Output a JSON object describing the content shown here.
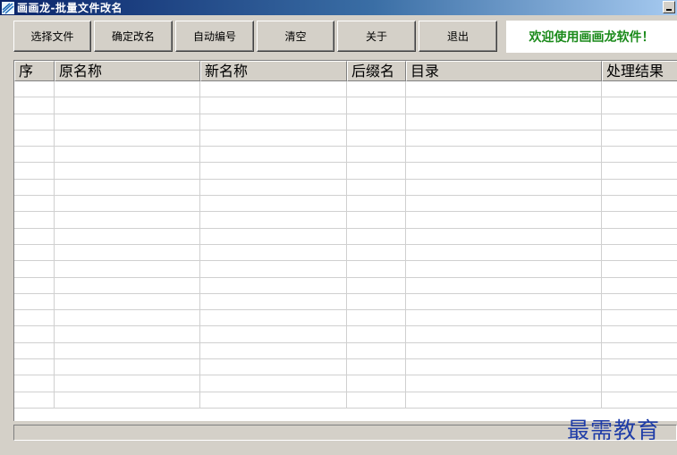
{
  "window": {
    "title": "画画龙-批量文件改名"
  },
  "toolbar": {
    "select_files": "选择文件",
    "confirm_rename": "确定改名",
    "auto_number": "自动编号",
    "clear": "清空",
    "about": "关于",
    "exit": "退出"
  },
  "welcome": "欢迎使用画画龙软件！",
  "grid": {
    "columns": [
      "序",
      "原名称",
      "新名称",
      "后缀名",
      "目录",
      "处理结果"
    ],
    "row_count": 20
  },
  "watermark": "最需教育"
}
